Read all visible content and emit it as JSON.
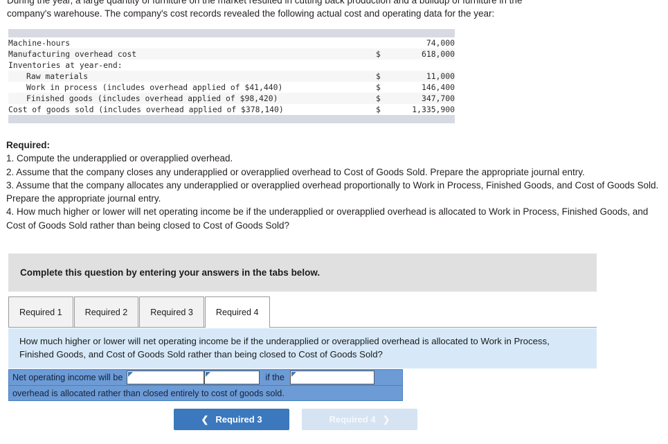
{
  "intro": {
    "line1": "During the year, a large quantity of furniture on the market resulted in cutting back production and a buildup of furniture in the",
    "line2": "company's warehouse. The company's cost records revealed the following actual cost and operating data for the year:"
  },
  "data_table": {
    "rows": [
      {
        "label": "Machine-hours",
        "indent": 0,
        "currency": "",
        "value": "74,000"
      },
      {
        "label": "Manufacturing overhead cost",
        "indent": 0,
        "currency": "$",
        "value": "618,000"
      },
      {
        "label": "Inventories at year-end:",
        "indent": 0,
        "currency": "",
        "value": ""
      },
      {
        "label": "Raw materials",
        "indent": 1,
        "currency": "$",
        "value": "11,000"
      },
      {
        "label": "Work in process (includes overhead applied of $41,440)",
        "indent": 1,
        "currency": "$",
        "value": "146,400"
      },
      {
        "label": "Finished goods (includes overhead applied of $98,420)",
        "indent": 1,
        "currency": "$",
        "value": "347,700"
      },
      {
        "label": "Cost of goods sold (includes overhead applied of $378,140)",
        "indent": 0,
        "currency": "$",
        "value": "1,335,900"
      }
    ]
  },
  "required": {
    "heading": "Required:",
    "items": [
      "1. Compute the underapplied or overapplied overhead.",
      "2. Assume that the company closes any underapplied or overapplied overhead to Cost of Goods Sold. Prepare the appropriate journal entry.",
      "3. Assume that the company allocates any underapplied or overapplied overhead proportionally to Work in Process, Finished Goods, and Cost of Goods Sold. Prepare the appropriate journal entry.",
      "4. How much higher or lower will net operating income be if the underapplied or overapplied overhead is allocated to Work in Process, Finished Goods, and Cost of Goods Sold rather than being closed to Cost of Goods Sold?"
    ]
  },
  "instruction_bar": {
    "text": "Complete this question by entering your answers in the tabs below."
  },
  "tabs": [
    {
      "label": "Required 1",
      "active": false
    },
    {
      "label": "Required 2",
      "active": false
    },
    {
      "label": "Required 3",
      "active": false
    },
    {
      "label": "Required 4",
      "active": true
    }
  ],
  "question_panel": {
    "text": "How much higher or lower will net operating income be if the underapplied or overapplied overhead is allocated to Work in Process, Finished Goods, and Cost of Goods Sold rather than being closed to Cost of Goods Sold?"
  },
  "answer_form": {
    "lead_label": "Net operating income will be",
    "mid_label": "if the",
    "trailing_text": "overhead is allocated rather than closed entirely to cost of goods sold.",
    "field1_value": "",
    "field2_value": "",
    "field3_value": ""
  },
  "navigation": {
    "prev_label": "Required 3",
    "prev_icon": "chevron-left-icon",
    "next_label": "Required 4",
    "next_icon": "chevron-right-icon"
  },
  "colors": {
    "primary_button": "#3b78bd",
    "disabled_button": "#d6e3f2",
    "question_panel": "#d7e9f9",
    "answer_row": "#6c9bd6",
    "instruction_bar": "#e0e0e0",
    "table_cap": "#d7dae3"
  }
}
